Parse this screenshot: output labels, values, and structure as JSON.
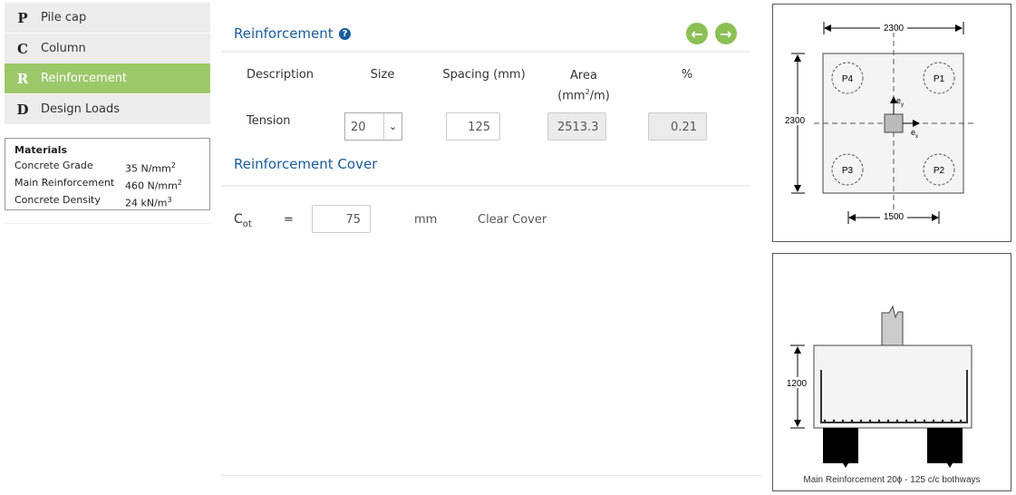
{
  "sidebar": {
    "items": [
      {
        "letter": "P",
        "label": "Pile cap"
      },
      {
        "letter": "C",
        "label": "Column"
      },
      {
        "letter": "R",
        "label": "Reinforcement",
        "active": true
      },
      {
        "letter": "D",
        "label": "Design Loads"
      }
    ]
  },
  "materials": {
    "title": "Materials",
    "rows": [
      {
        "label": "Concrete Grade",
        "value": "35 N/mm",
        "sup": "2"
      },
      {
        "label": "Main Reinforcement",
        "value": "460 N/mm",
        "sup": "2"
      },
      {
        "label": "Concrete Density",
        "value": "24 kN/m",
        "sup": "3"
      }
    ]
  },
  "main": {
    "title": "Reinforcement",
    "help_icon": "question-circle-icon",
    "prev_icon": "arrow-left-circle-icon",
    "next_icon": "arrow-right-circle-icon",
    "accent": "#8bc055",
    "columns": {
      "description": "Description",
      "size": "Size",
      "spacing": "Spacing (mm)",
      "area": "Area",
      "area_unit_a": "(mm",
      "area_unit_sup": "2",
      "area_unit_b": "/m)",
      "percent": "%"
    },
    "row": {
      "description": "Tension",
      "size": "20",
      "spacing": "125",
      "area": "2513.3",
      "percent": "0.21"
    },
    "cover_title": "Reinforcement Cover",
    "cover": {
      "symbol": "C",
      "subscript": "ot",
      "equals": "=",
      "value": "75",
      "unit": "mm",
      "label": "Clear Cover"
    }
  },
  "plan_diagram": {
    "width_label": "2300",
    "height_label": "2300",
    "pile_spacing_label": "1500",
    "piles": [
      "P1",
      "P2",
      "P3",
      "P4"
    ],
    "ex": "e",
    "ex_sub": "x",
    "ey": "e",
    "ey_sub": "y"
  },
  "section_diagram": {
    "depth_label": "1200",
    "caption": "Main Reinforcement 20ϕ - 125 c/c bothways"
  }
}
